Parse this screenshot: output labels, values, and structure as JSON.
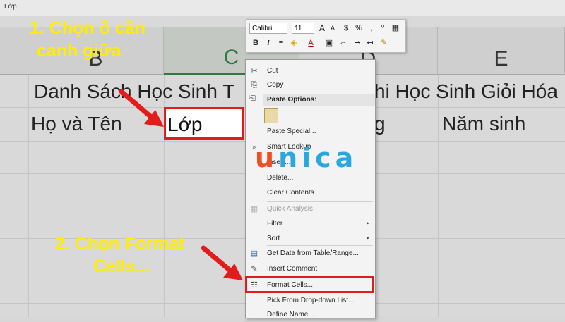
{
  "formula_bar": {
    "value": "Lớp"
  },
  "columns": [
    "B",
    "C",
    "D",
    "E"
  ],
  "cells": {
    "row1_b": "Danh Sách Học Sinh T",
    "row1_d": "hi Học Sinh Giỏi Hóa",
    "row2_b": "Họ và Tên",
    "row2_c": "Lớp",
    "row2_d": "g",
    "row2_e": "Năm sinh"
  },
  "annotations": {
    "step1_line1": "1. Chọn ô cần",
    "step1_line2": "canh giữa",
    "step2_line1": "2. Chọn Format",
    "step2_line2": "Cells..."
  },
  "mini_toolbar": {
    "font": "Calibri",
    "size": "11",
    "grow": "A",
    "shrink": "A",
    "currency": "$",
    "percent": "%",
    "comma": ",",
    "bold": "B",
    "italic": "I",
    "font_color": "A"
  },
  "context_menu": {
    "items": [
      {
        "label": "Cut",
        "icon": "scissors-icon",
        "glyph": "✂"
      },
      {
        "label": "Copy",
        "icon": "copy-icon",
        "glyph": "⎘"
      },
      {
        "label": "Paste Options:",
        "icon": "clipboard-icon",
        "glyph": "📋"
      },
      {
        "label": "Paste Special...",
        "icon": "",
        "glyph": ""
      },
      {
        "label": "Smart Lookup",
        "icon": "search-icon",
        "glyph": "⌕"
      },
      {
        "label": "Insert...",
        "icon": "",
        "glyph": ""
      },
      {
        "label": "Delete...",
        "icon": "",
        "glyph": ""
      },
      {
        "label": "Clear Contents",
        "icon": "",
        "glyph": ""
      },
      {
        "label": "Quick Analysis",
        "icon": "quick-analysis-icon",
        "glyph": "▦",
        "disabled": true
      },
      {
        "label": "Filter",
        "icon": "",
        "glyph": "",
        "submenu": true
      },
      {
        "label": "Sort",
        "icon": "",
        "glyph": "",
        "submenu": true
      },
      {
        "label": "Get Data from Table/Range...",
        "icon": "table-icon",
        "glyph": "▤"
      },
      {
        "label": "Insert Comment",
        "icon": "comment-icon",
        "glyph": "✎"
      },
      {
        "label": "Format Cells...",
        "icon": "format-cells-icon",
        "glyph": "☷"
      },
      {
        "label": "Pick From Drop-down List...",
        "icon": "",
        "glyph": ""
      },
      {
        "label": "Define Name...",
        "icon": "",
        "glyph": ""
      }
    ],
    "submenu_arrow": "▸"
  },
  "logo": {
    "first": "u",
    "rest": "nica"
  },
  "colors": {
    "annotation_yellow": "#ffee00",
    "highlight_red": "#e21b1b",
    "excel_green": "#2f7a44",
    "logo_orange": "#f04e23",
    "logo_blue": "#2aa7e0"
  }
}
